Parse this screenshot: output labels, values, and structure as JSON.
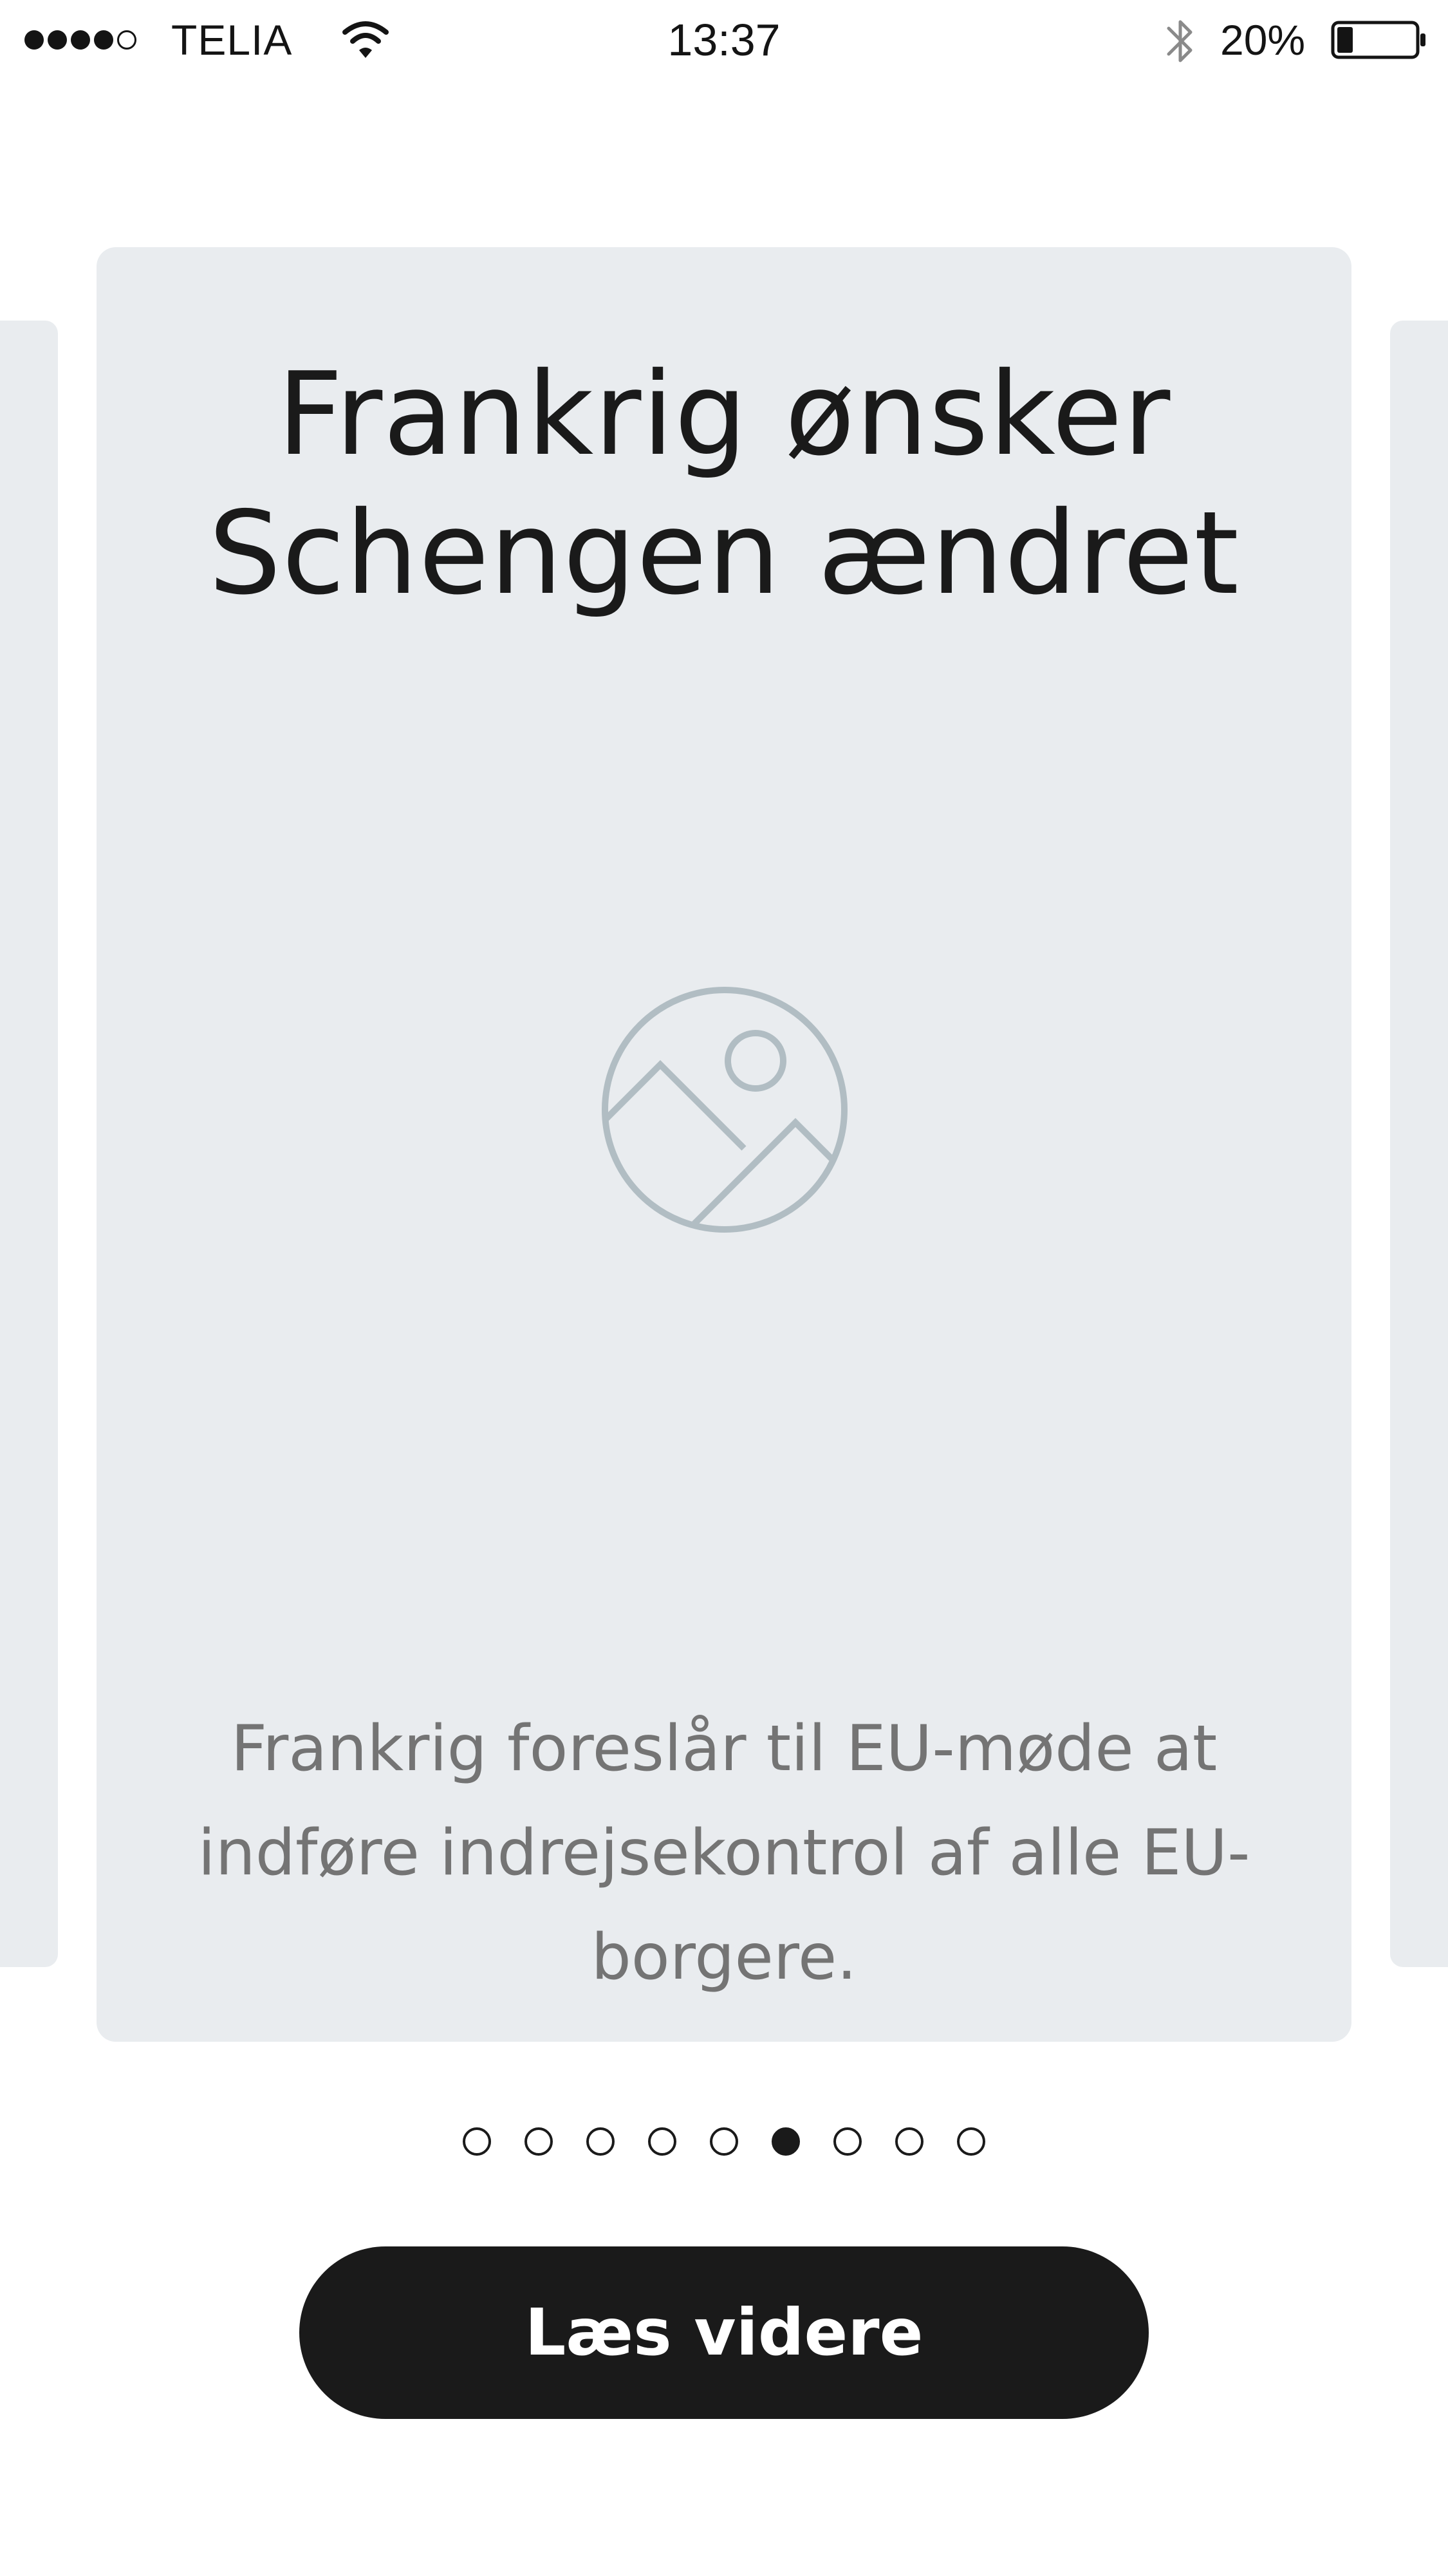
{
  "status_bar": {
    "signal_bars": [
      true,
      true,
      true,
      true,
      false
    ],
    "carrier": "TELIA",
    "wifi_icon": "wifi-icon",
    "time": "13:37",
    "bluetooth_icon": "bluetooth-icon",
    "battery_percent": "20%",
    "battery_level": 0.2
  },
  "card": {
    "title": "Frankrig ønsker Schengen ændret",
    "image_icon": "image-placeholder-icon",
    "summary": "Frankrig foreslår til EU-møde at indføre indrejsekontrol af alle EU-borgere."
  },
  "pagination": {
    "total": 9,
    "active_index": 5
  },
  "button": {
    "label": "Læs videre"
  },
  "colors": {
    "card_background": "#e9ecef",
    "button_background": "#1a1a1a",
    "summary_text": "#747474",
    "placeholder_icon": "#b1bdc3"
  }
}
